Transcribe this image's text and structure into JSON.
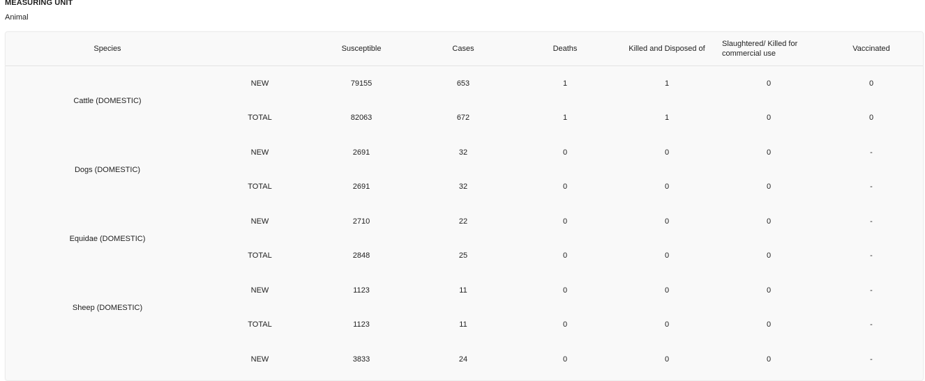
{
  "measuring_unit": {
    "title": "MEASURING UNIT",
    "value": "Animal"
  },
  "table": {
    "headers": {
      "species": "Species",
      "type": "",
      "susceptible": "Susceptible",
      "cases": "Cases",
      "deaths": "Deaths",
      "killed": "Killed and Disposed of",
      "slaughtered": "Slaughtered/ Killed for commercial use",
      "vaccinated": "Vaccinated"
    },
    "groups": [
      {
        "species": "Cattle (DOMESTIC)",
        "rows": [
          {
            "type": "NEW",
            "susceptible": "79155",
            "cases": "653",
            "deaths": "1",
            "killed": "1",
            "slaughtered": "0",
            "vaccinated": "0"
          },
          {
            "type": "TOTAL",
            "susceptible": "82063",
            "cases": "672",
            "deaths": "1",
            "killed": "1",
            "slaughtered": "0",
            "vaccinated": "0"
          }
        ]
      },
      {
        "species": "Dogs (DOMESTIC)",
        "rows": [
          {
            "type": "NEW",
            "susceptible": "2691",
            "cases": "32",
            "deaths": "0",
            "killed": "0",
            "slaughtered": "0",
            "vaccinated": "-"
          },
          {
            "type": "TOTAL",
            "susceptible": "2691",
            "cases": "32",
            "deaths": "0",
            "killed": "0",
            "slaughtered": "0",
            "vaccinated": "-"
          }
        ]
      },
      {
        "species": "Equidae (DOMESTIC)",
        "rows": [
          {
            "type": "NEW",
            "susceptible": "2710",
            "cases": "22",
            "deaths": "0",
            "killed": "0",
            "slaughtered": "0",
            "vaccinated": "-"
          },
          {
            "type": "TOTAL",
            "susceptible": "2848",
            "cases": "25",
            "deaths": "0",
            "killed": "0",
            "slaughtered": "0",
            "vaccinated": "-"
          }
        ]
      },
      {
        "species": "Sheep (DOMESTIC)",
        "rows": [
          {
            "type": "NEW",
            "susceptible": "1123",
            "cases": "11",
            "deaths": "0",
            "killed": "0",
            "slaughtered": "0",
            "vaccinated": "-"
          },
          {
            "type": "TOTAL",
            "susceptible": "1123",
            "cases": "11",
            "deaths": "0",
            "killed": "0",
            "slaughtered": "0",
            "vaccinated": "-"
          }
        ]
      },
      {
        "species": "",
        "rows": [
          {
            "type": "NEW",
            "susceptible": "3833",
            "cases": "24",
            "deaths": "0",
            "killed": "0",
            "slaughtered": "0",
            "vaccinated": "-"
          }
        ]
      }
    ]
  }
}
